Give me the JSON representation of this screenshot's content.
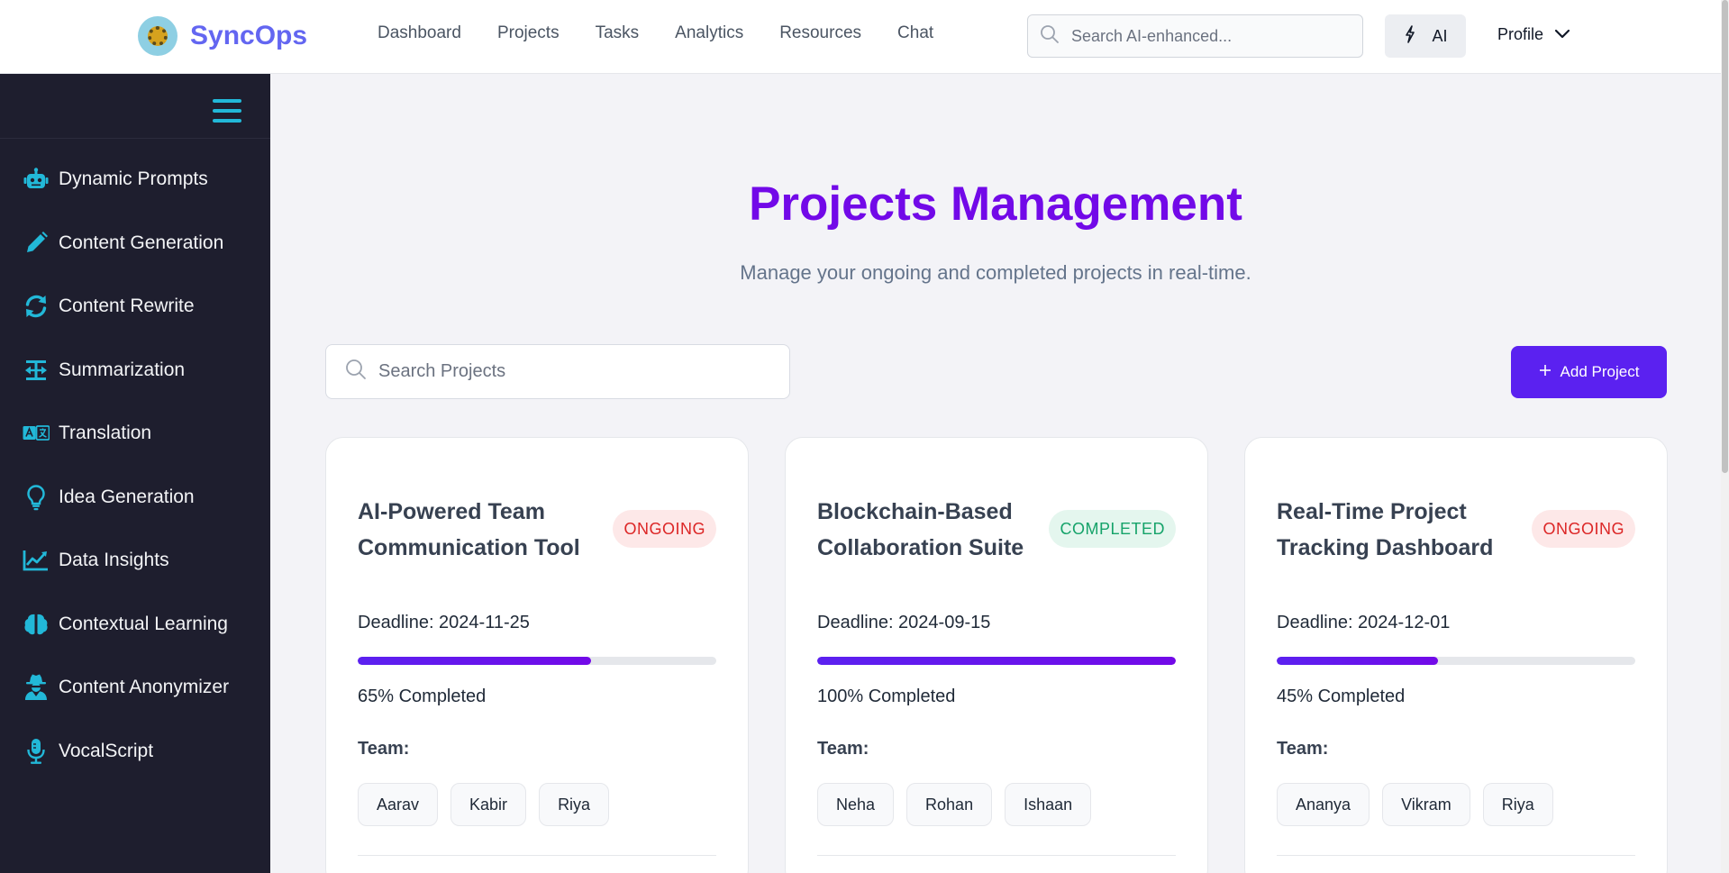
{
  "brand": {
    "name": "SyncOps",
    "accent": "#6366f1"
  },
  "nav": {
    "items": [
      {
        "label": "Dashboard"
      },
      {
        "label": "Projects"
      },
      {
        "label": "Tasks"
      },
      {
        "label": "Analytics"
      },
      {
        "label": "Resources"
      },
      {
        "label": "Chat"
      }
    ],
    "search_placeholder": "Search AI-enhanced...",
    "ai_label": "AI",
    "profile_label": "Profile"
  },
  "sidebar": {
    "items": [
      {
        "label": "Dynamic Prompts",
        "icon": "robot-icon"
      },
      {
        "label": "Content Generation",
        "icon": "pencil-icon"
      },
      {
        "label": "Content Rewrite",
        "icon": "refresh-icon"
      },
      {
        "label": "Summarization",
        "icon": "compress-icon"
      },
      {
        "label": "Translation",
        "icon": "language-icon"
      },
      {
        "label": "Idea Generation",
        "icon": "lightbulb-icon"
      },
      {
        "label": "Data Insights",
        "icon": "chart-line-icon"
      },
      {
        "label": "Contextual Learning",
        "icon": "brain-icon"
      },
      {
        "label": "Content Anonymizer",
        "icon": "user-secret-icon"
      },
      {
        "label": "VocalScript",
        "icon": "microphone-icon"
      }
    ]
  },
  "main": {
    "title": "Projects Management",
    "subtitle": "Manage your ongoing and completed projects in real-time.",
    "search_placeholder": "Search Projects",
    "add_label": "Add Project",
    "title_color": "#7209e8",
    "button_color": "#5b21f0"
  },
  "projects": [
    {
      "title": "AI-Powered Team Communication Tool",
      "status": "ONGOING",
      "deadline": "Deadline: 2024-11-25",
      "progress": 65,
      "progress_text": "65% Completed",
      "team_label": "Team:",
      "team": [
        "Aarav",
        "Kabir",
        "Riya"
      ]
    },
    {
      "title": "Blockchain-Based Collaboration Suite",
      "status": "COMPLETED",
      "deadline": "Deadline: 2024-09-15",
      "progress": 100,
      "progress_text": "100% Completed",
      "team_label": "Team:",
      "team": [
        "Neha",
        "Rohan",
        "Ishaan"
      ]
    },
    {
      "title": "Real-Time Project Tracking Dashboard",
      "status": "ONGOING",
      "deadline": "Deadline: 2024-12-01",
      "progress": 45,
      "progress_text": "45% Completed",
      "team_label": "Team:",
      "team": [
        "Ananya",
        "Vikram",
        "Riya"
      ]
    }
  ]
}
